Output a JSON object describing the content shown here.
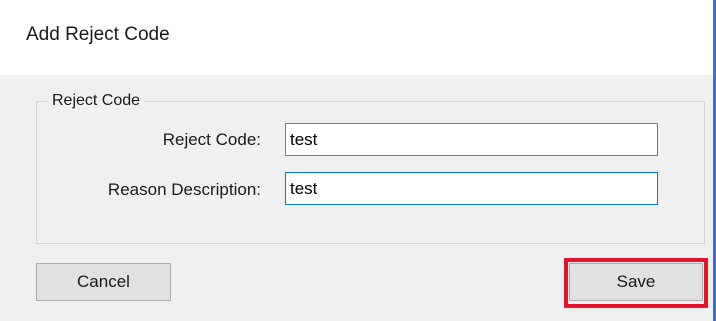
{
  "dialog": {
    "title": "Add Reject Code"
  },
  "group": {
    "label": "Reject Code"
  },
  "fields": {
    "reject_code": {
      "label": "Reject Code:",
      "value": "test"
    },
    "reason_description": {
      "label": "Reason Description:",
      "value": "test"
    }
  },
  "buttons": {
    "cancel_label": "Cancel",
    "save_label": "Save"
  },
  "colors": {
    "window_border": "#2b79d6",
    "highlight": "#e5142b",
    "focus_border": "#0078d7"
  }
}
